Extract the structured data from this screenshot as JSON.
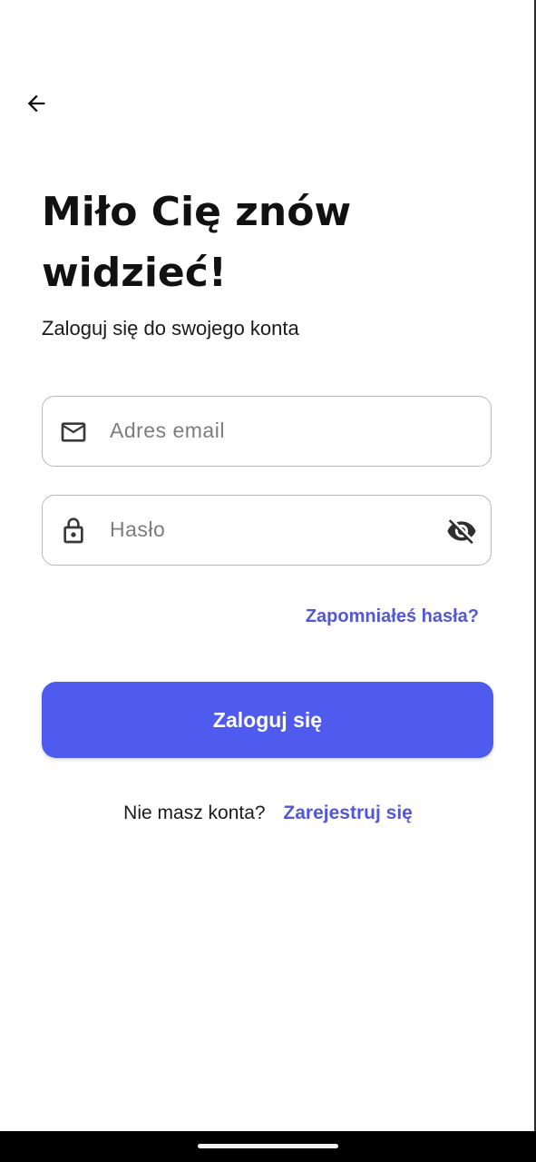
{
  "header": {
    "back_icon": "arrow-left-icon"
  },
  "main": {
    "title_line1": "Miło Cię znów",
    "title_line2": "widzieć!",
    "subtitle": "Zaloguj się do swojego konta"
  },
  "form": {
    "email": {
      "placeholder": "Adres email",
      "value": "",
      "icon": "mail-icon"
    },
    "password": {
      "placeholder": "Hasło",
      "value": "",
      "icon": "lock-icon",
      "toggle_icon": "eye-off-icon"
    },
    "forgot_password_label": "Zapomniałeś hasła?",
    "login_button_label": "Zaloguj się"
  },
  "footer": {
    "register_prompt": "Nie masz konta?",
    "register_link_label": "Zarejestruj się"
  },
  "colors": {
    "accent": "#4f5bef",
    "link": "#5257d6",
    "border": "#b8b8b8",
    "text": "#111111"
  }
}
